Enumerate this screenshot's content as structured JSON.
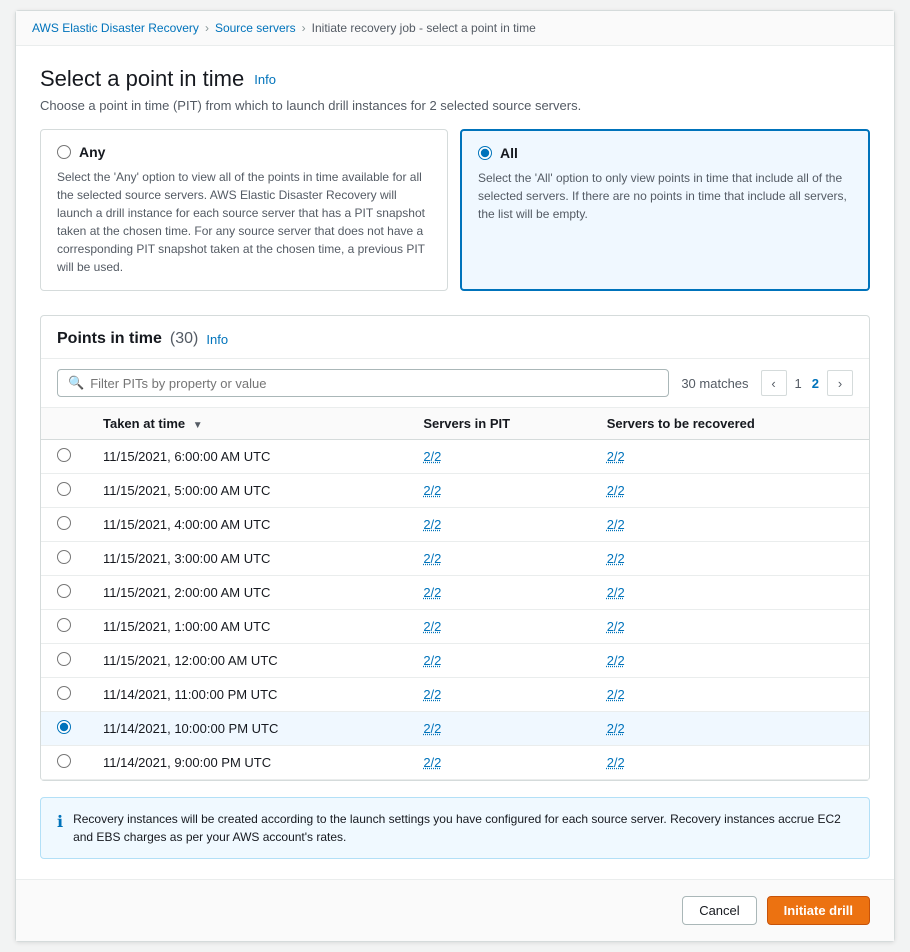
{
  "breadcrumb": {
    "items": [
      {
        "label": "AWS Elastic Disaster Recovery",
        "href": "#"
      },
      {
        "label": "Source servers",
        "href": "#"
      },
      {
        "label": "Initiate recovery job - select a point in time",
        "href": null
      }
    ]
  },
  "page": {
    "title": "Select a point in time",
    "info_label": "Info",
    "subtitle": "Choose a point in time (PIT) from which to launch drill instances for 2 selected source servers."
  },
  "options": [
    {
      "id": "any",
      "label": "Any",
      "description": "Select the 'Any' option to view all of the points in time available for all the selected source servers. AWS Elastic Disaster Recovery will launch a drill instance for each source server that has a PIT snapshot taken at the chosen time. For any source server that does not have a corresponding PIT snapshot taken at the chosen time, a previous PIT will be used.",
      "selected": false
    },
    {
      "id": "all",
      "label": "All",
      "description": "Select the 'All' option to only view points in time that include all of the selected servers. If there are no points in time that include all servers, the list will be empty.",
      "selected": true
    }
  ],
  "points_section": {
    "title": "Points in time",
    "count": "(30)",
    "info_label": "Info",
    "search_placeholder": "Filter PITs by property or value",
    "matches_text": "30 matches",
    "pagination": {
      "prev_disabled": true,
      "pages": [
        "1",
        "2"
      ],
      "active_page": "2",
      "next_enabled": true
    }
  },
  "table": {
    "columns": [
      {
        "key": "radio",
        "label": ""
      },
      {
        "key": "taken_at",
        "label": "Taken at time",
        "sortable": true
      },
      {
        "key": "servers_in_pit",
        "label": "Servers in PIT"
      },
      {
        "key": "servers_to_recover",
        "label": "Servers to be recovered"
      }
    ],
    "rows": [
      {
        "id": 1,
        "taken_at": "11/15/2021, 6:00:00 AM UTC",
        "servers_in_pit": "2/2",
        "servers_to_recover": "2/2",
        "selected": false
      },
      {
        "id": 2,
        "taken_at": "11/15/2021, 5:00:00 AM UTC",
        "servers_in_pit": "2/2",
        "servers_to_recover": "2/2",
        "selected": false
      },
      {
        "id": 3,
        "taken_at": "11/15/2021, 4:00:00 AM UTC",
        "servers_in_pit": "2/2",
        "servers_to_recover": "2/2",
        "selected": false
      },
      {
        "id": 4,
        "taken_at": "11/15/2021, 3:00:00 AM UTC",
        "servers_in_pit": "2/2",
        "servers_to_recover": "2/2",
        "selected": false
      },
      {
        "id": 5,
        "taken_at": "11/15/2021, 2:00:00 AM UTC",
        "servers_in_pit": "2/2",
        "servers_to_recover": "2/2",
        "selected": false
      },
      {
        "id": 6,
        "taken_at": "11/15/2021, 1:00:00 AM UTC",
        "servers_in_pit": "2/2",
        "servers_to_recover": "2/2",
        "selected": false
      },
      {
        "id": 7,
        "taken_at": "11/15/2021, 12:00:00 AM UTC",
        "servers_in_pit": "2/2",
        "servers_to_recover": "2/2",
        "selected": false
      },
      {
        "id": 8,
        "taken_at": "11/14/2021, 11:00:00 PM UTC",
        "servers_in_pit": "2/2",
        "servers_to_recover": "2/2",
        "selected": false
      },
      {
        "id": 9,
        "taken_at": "11/14/2021, 10:00:00 PM UTC",
        "servers_in_pit": "2/2",
        "servers_to_recover": "2/2",
        "selected": true
      },
      {
        "id": 10,
        "taken_at": "11/14/2021, 9:00:00 PM UTC",
        "servers_in_pit": "2/2",
        "servers_to_recover": "2/2",
        "selected": false
      }
    ]
  },
  "info_banner": {
    "text": "Recovery instances will be created according to the launch settings you have configured for each source server. Recovery instances accrue EC2 and EBS charges as per your AWS account's rates."
  },
  "footer": {
    "cancel_label": "Cancel",
    "primary_label": "Initiate drill"
  }
}
